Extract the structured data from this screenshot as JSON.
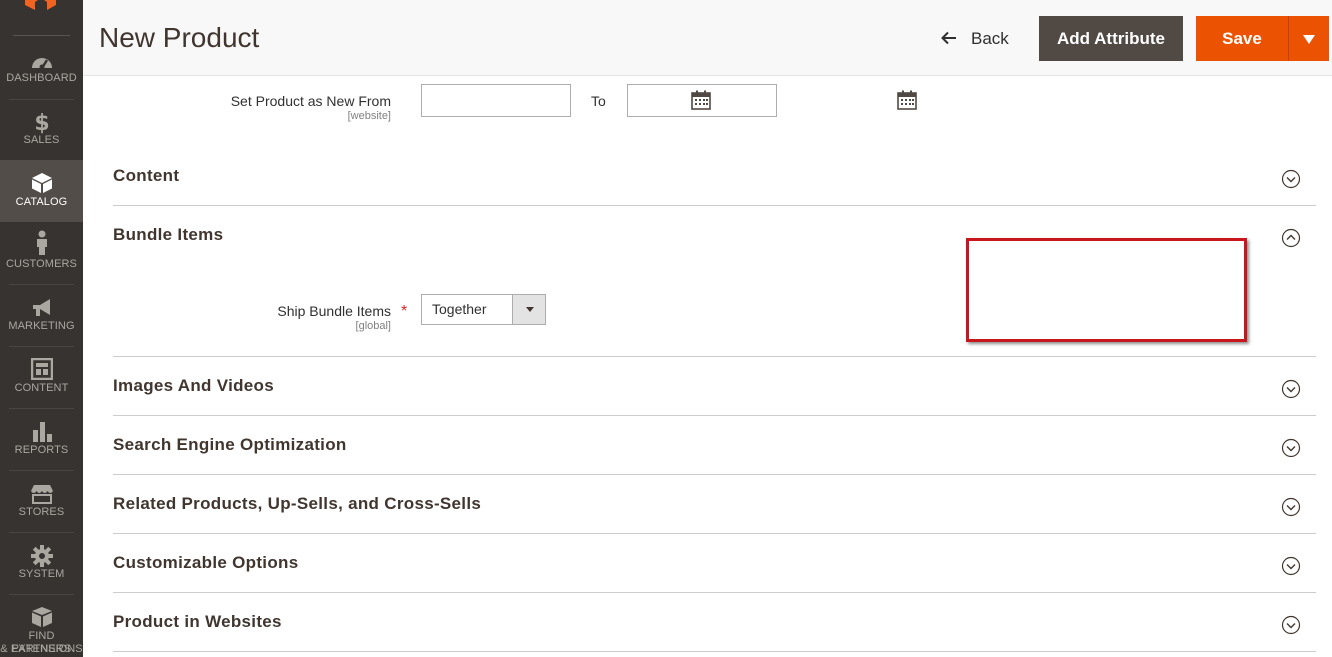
{
  "sidebar": {
    "logo_icon": "magento-logo-icon",
    "items": [
      {
        "label": "DASHBOARD",
        "icon": "dashboard-icon"
      },
      {
        "label": "SALES",
        "icon": "dollar-icon"
      },
      {
        "label": "CATALOG",
        "icon": "catalog-box-icon",
        "active": true
      },
      {
        "label": "CUSTOMERS",
        "icon": "person-icon"
      },
      {
        "label": "MARKETING",
        "icon": "megaphone-icon"
      },
      {
        "label": "CONTENT",
        "icon": "content-layout-icon"
      },
      {
        "label": "REPORTS",
        "icon": "bar-chart-icon"
      },
      {
        "label": "STORES",
        "icon": "storefront-icon"
      },
      {
        "label": "SYSTEM",
        "icon": "gear-icon"
      },
      {
        "label_line1": "FIND PARTNERS",
        "label_line2": "& EXTENSIONS",
        "icon": "boxes-icon"
      }
    ]
  },
  "header": {
    "title": "New Product",
    "back_label": "Back",
    "add_attribute_label": "Add Attribute",
    "save_label": "Save"
  },
  "new_from": {
    "label": "Set Product as New From",
    "scope": "[website]",
    "from_value": "",
    "to_label": "To",
    "to_value": ""
  },
  "sections": {
    "content": "Content",
    "bundle_items": "Bundle Items",
    "images_videos": "Images And Videos",
    "seo": "Search Engine Optimization",
    "related": "Related Products, Up-Sells, and Cross-Sells",
    "custom_options": "Customizable Options",
    "websites": "Product in Websites"
  },
  "ship_bundle": {
    "label": "Ship Bundle Items",
    "required_mark": "*",
    "scope": "[global]",
    "value": "Together"
  },
  "colors": {
    "sidebar_bg": "#373330",
    "sidebar_active": "#524d49",
    "save_orange": "#eb5202",
    "add_attribute_bg": "#514943",
    "highlight_red": "#c8161d"
  }
}
